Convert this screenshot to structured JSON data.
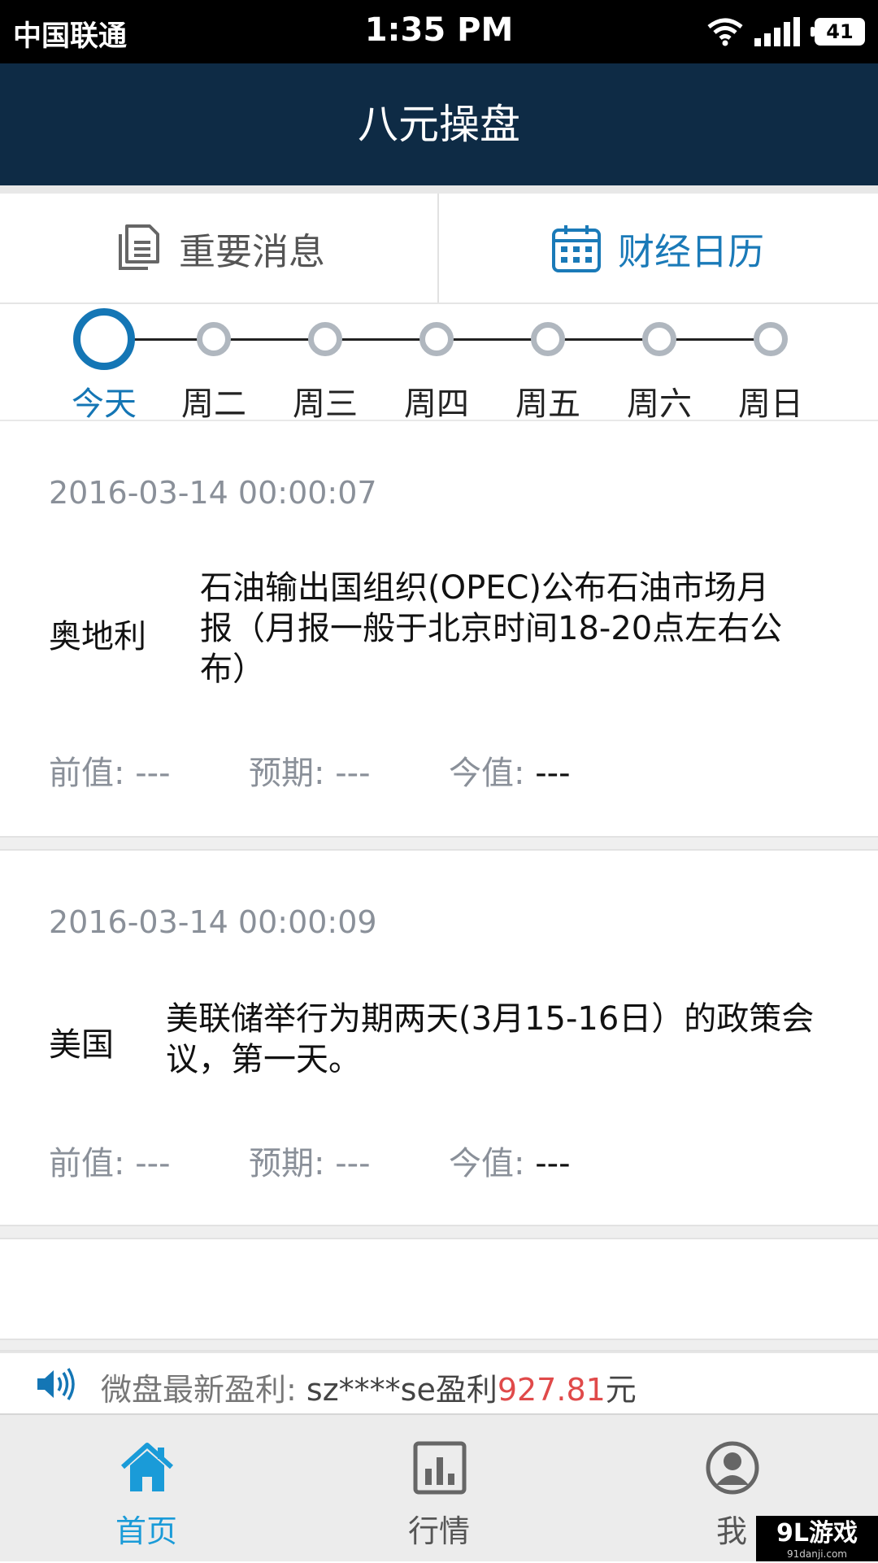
{
  "status_bar": {
    "carrier": "中国联通",
    "time": "1:35 PM",
    "battery": "41"
  },
  "header": {
    "title": "八元操盘"
  },
  "tabs": [
    {
      "label": "重要消息",
      "icon": "document-icon"
    },
    {
      "label": "财经日历",
      "icon": "calendar-icon"
    }
  ],
  "days": [
    "今天",
    "周二",
    "周三",
    "周四",
    "周五",
    "周六",
    "周日"
  ],
  "events": [
    {
      "datetime": "2016-03-14  00:00:07",
      "country": "奥地利",
      "desc_lines": [
        "石油输出国组织(OPEC)公布石油市场月",
        "报（月报一般于北京时间18-20点左右公",
        "布）"
      ],
      "prev_label": "前值:",
      "prev": "---",
      "expect_label": "预期:",
      "expect": "---",
      "actual_label": "今值:",
      "actual": "---"
    },
    {
      "datetime": "2016-03-14  00:00:09",
      "country": "美国",
      "desc_lines": [
        "美联储举行为期两天(3月15-16日）的政策会",
        "议，第一天。"
      ],
      "prev_label": "前值:",
      "prev": "---",
      "expect_label": "预期:",
      "expect": "---",
      "actual_label": "今值:",
      "actual": "---"
    }
  ],
  "ticker": {
    "label": "微盘最新盈利:",
    "user": "sz****se盈利",
    "amount": "927.81",
    "unit": "元"
  },
  "nav": [
    {
      "label": "首页",
      "icon": "home-icon"
    },
    {
      "label": "行情",
      "icon": "chart-icon"
    },
    {
      "label": "我",
      "icon": "profile-icon"
    }
  ],
  "watermark": {
    "text": "9L游戏",
    "sub": "91danji.com"
  },
  "colors": {
    "header_bg": "#0e2b45",
    "accent": "#1476b5",
    "profit": "#e04a4a"
  }
}
